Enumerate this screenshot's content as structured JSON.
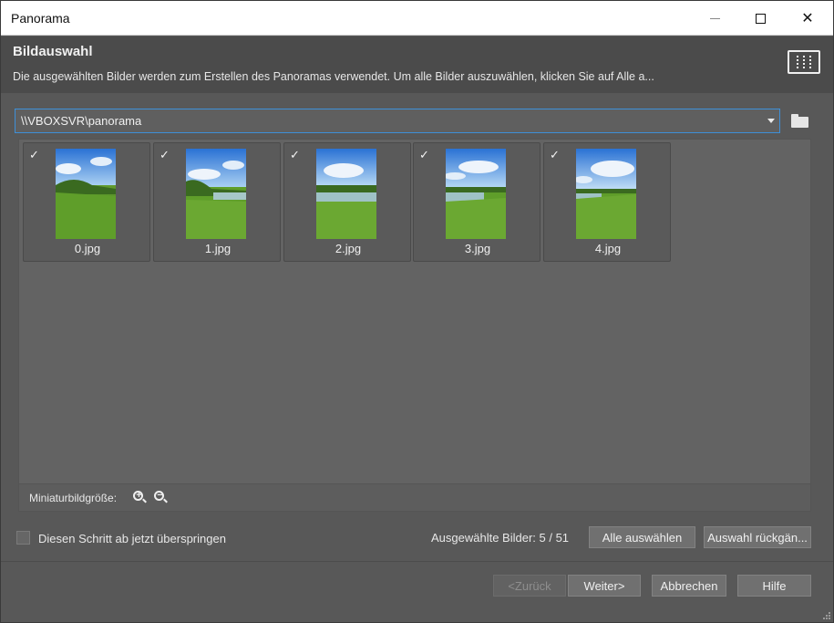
{
  "window": {
    "title": "Panorama"
  },
  "header": {
    "title": "Bildauswahl",
    "description": "Die ausgewählten Bilder werden zum Erstellen des Panoramas verwendet. Um alle Bilder auszuwählen, klicken Sie auf Alle a..."
  },
  "path": {
    "value": "\\\\VBOXSVR\\panorama"
  },
  "thumbnails": [
    {
      "name": "0.jpg",
      "checked": true
    },
    {
      "name": "1.jpg",
      "checked": true
    },
    {
      "name": "2.jpg",
      "checked": true
    },
    {
      "name": "3.jpg",
      "checked": true
    },
    {
      "name": "4.jpg",
      "checked": true
    }
  ],
  "thumb_size": {
    "label": "Miniaturbildgröße:",
    "zoom_in": "+",
    "zoom_out": "−"
  },
  "skip": {
    "label": "Diesen Schritt ab jetzt überspringen",
    "checked": false
  },
  "selection": {
    "count_label": "Ausgewählte Bilder: 5 / 51",
    "select_all": "Alle auswählen",
    "undo_selection": "Auswahl rückgän..."
  },
  "footer": {
    "back": "<Zurück",
    "next": "Weiter>",
    "cancel": "Abbrechen",
    "help": "Hilfe"
  },
  "icons": {
    "checkmark": "✓",
    "close": "✕"
  },
  "colors": {
    "focus_border": "#3e90d8",
    "background": "#585858"
  }
}
